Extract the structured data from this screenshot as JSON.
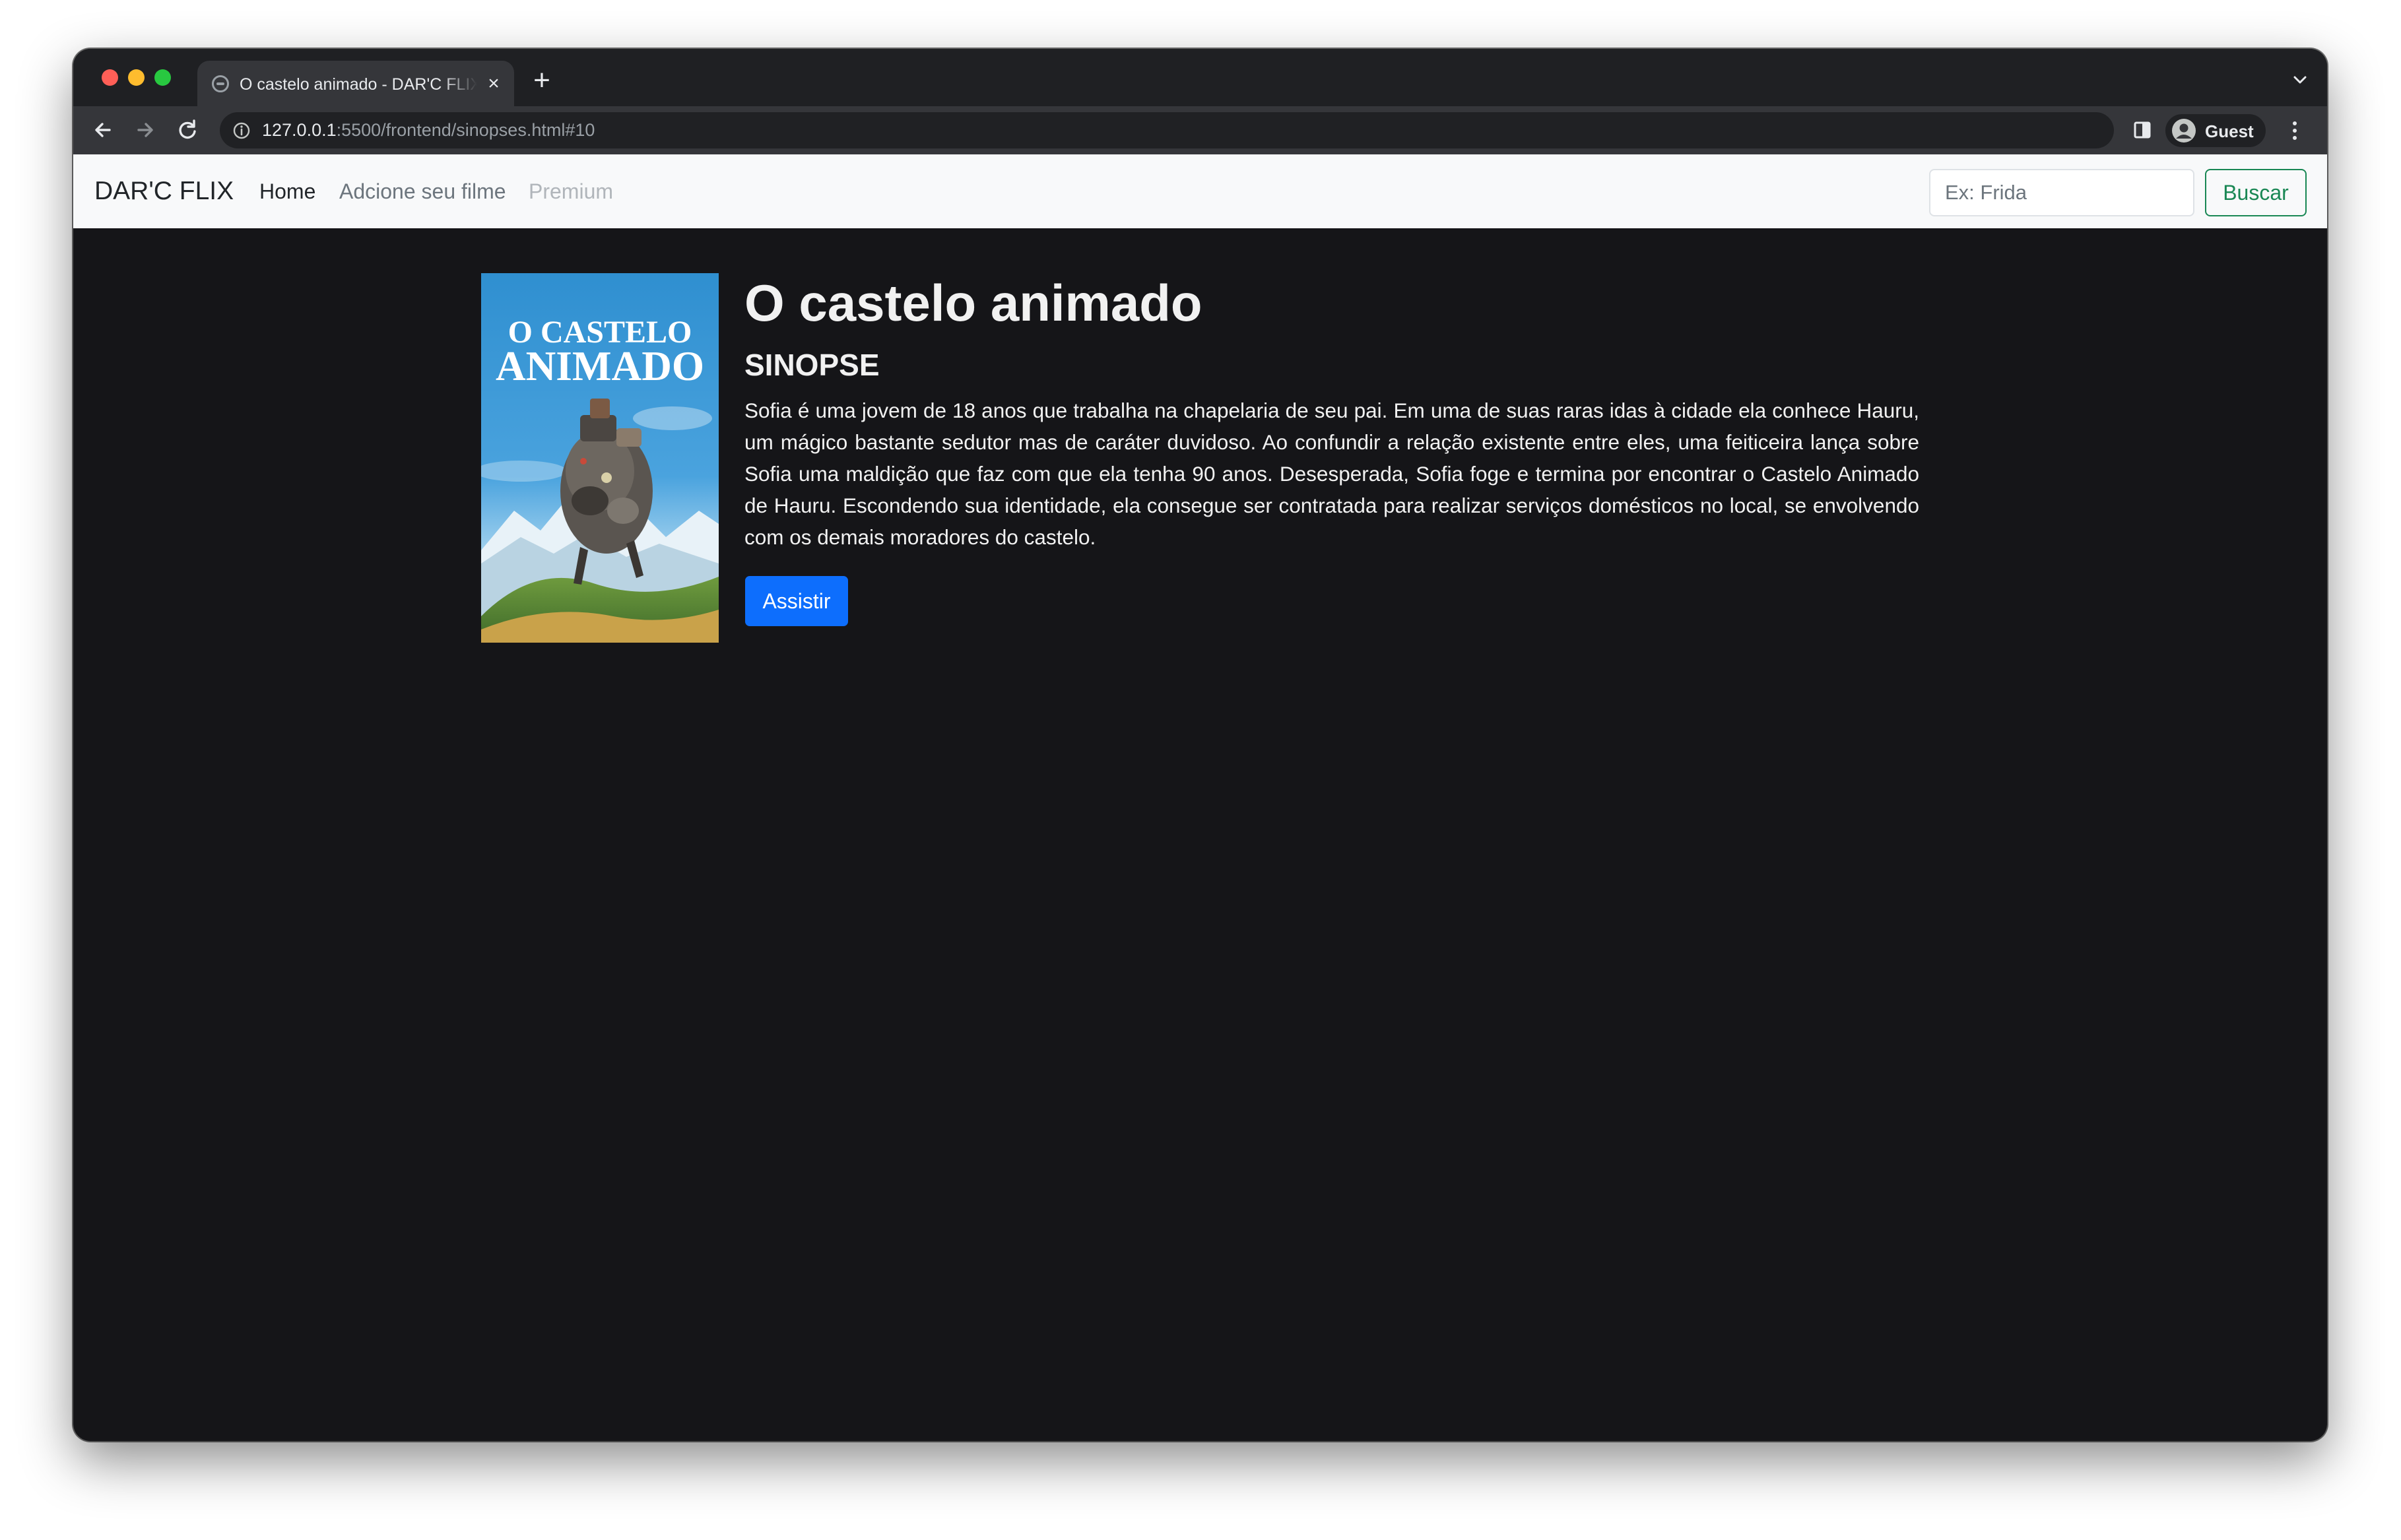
{
  "browser": {
    "tab_title": "O castelo animado - DAR'C FLIX",
    "url_host": "127.0.0.1",
    "url_path": ":5500/frontend/sinopses.html#10",
    "profile_name": "Guest"
  },
  "navbar": {
    "brand": "DAR'C FLIX",
    "links": [
      {
        "label": "Home",
        "state": "active"
      },
      {
        "label": "Adcione seu filme",
        "state": "normal"
      },
      {
        "label": "Premium",
        "state": "disabled"
      }
    ],
    "search_placeholder": "Ex: Frida",
    "search_button": "Buscar"
  },
  "movie": {
    "title": "O castelo animado",
    "synopsis_heading": "SINOPSE",
    "synopsis": "Sofia é uma jovem de 18 anos que trabalha na chapelaria de seu pai. Em uma de suas raras idas à cidade ela conhece Hauru, um mágico bastante sedutor mas de caráter duvidoso. Ao confundir a relação existente entre eles, uma feiticeira lança sobre Sofia uma maldição que faz com que ela tenha 90 anos. Desesperada, Sofia foge e termina por encontrar o Castelo Animado de Hauru. Escondendo sua identidade, ela consegue ser contratada para realizar serviços domésticos no local, se envolvendo com os demais moradores do castelo.",
    "watch_button": "Assistir",
    "poster_text": [
      "O CASTELO",
      "ANIMADO"
    ]
  },
  "colors": {
    "page_background": "#151518",
    "navbar_background": "#f8f9fa",
    "primary_button": "#0d6efd",
    "success_outline": "#198754"
  }
}
